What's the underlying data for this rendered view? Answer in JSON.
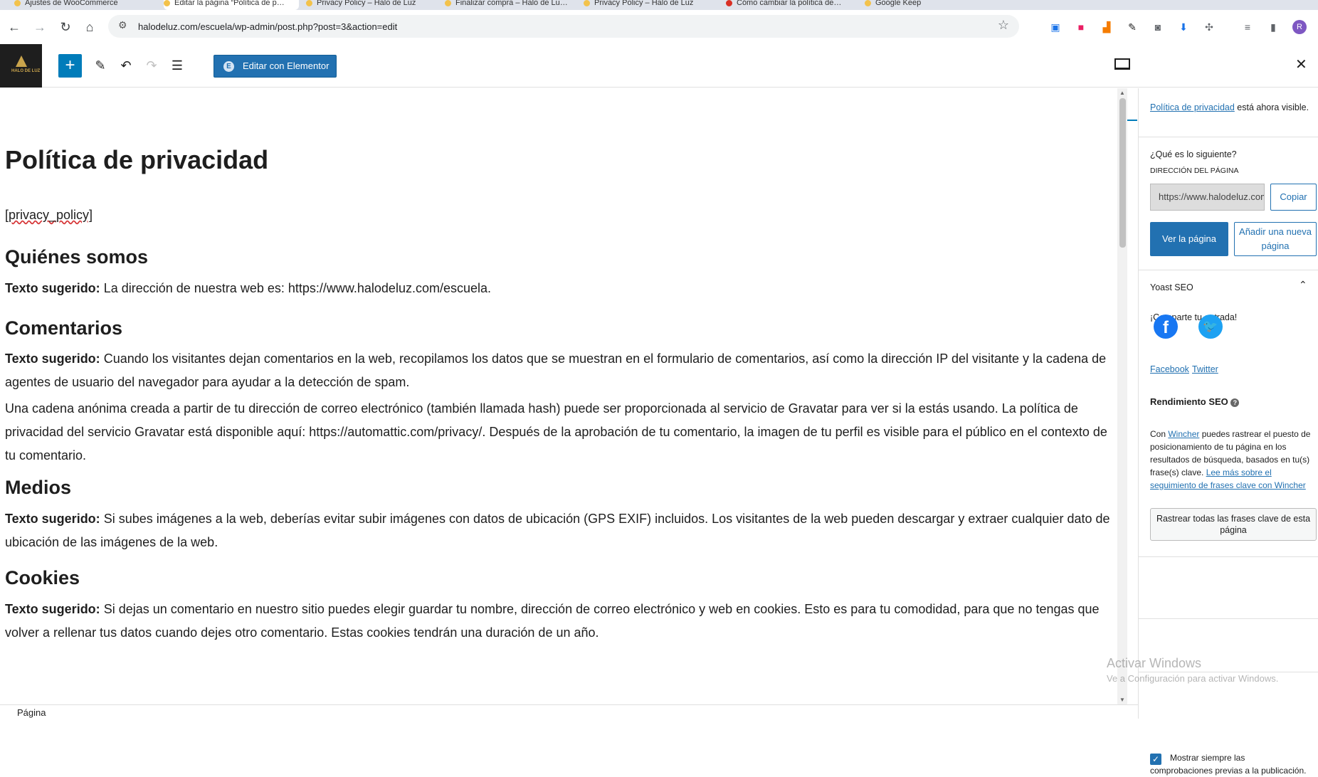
{
  "browser": {
    "tabs": [
      {
        "label": "Ajustes de WooCommerce"
      },
      {
        "label": "Editar la página “Política de p…"
      },
      {
        "label": "Privacy Policy – Halo de Luz"
      },
      {
        "label": "Finalizar compra – Halo de Lu…"
      },
      {
        "label": "Privacy Policy – Halo de Luz"
      },
      {
        "label": "Cómo cambiar la política de…"
      },
      {
        "label": "Google Keep"
      }
    ],
    "url": "halodeluz.com/escuela/wp-admin/post.php?post=3&action=edit",
    "profile_initial": "R"
  },
  "editor": {
    "logo_text": "HALO DE LUZ",
    "edit_elementor_label": "Editar con Elementor",
    "status_bar_label": "Página"
  },
  "content": {
    "title": "Política de privacidad",
    "shortcode": "[privacy_policy]",
    "sections": [
      {
        "heading": "Quiénes somos"
      },
      {
        "heading": "Comentarios"
      },
      {
        "heading": "Medios"
      },
      {
        "heading": "Cookies"
      }
    ],
    "suggested_label": "Texto sugerido:",
    "p_quienes": "La dirección de nuestra web es: https://www.halodeluz.com/escuela.",
    "p_comentarios_1": "Cuando los visitantes dejan comentarios en la web, recopilamos los datos que se muestran en el formulario de comentarios, así como la dirección IP del visitante y la cadena de agentes de usuario del navegador para ayudar a la detección de spam.",
    "p_comentarios_2": "Una cadena anónima creada a partir de tu dirección de correo electrónico (también llamada hash) puede ser proporcionada al servicio de Gravatar para ver si la estás usando. La política de privacidad del servicio Gravatar está disponible aquí: https://automattic.com/privacy/. Después de la aprobación de tu comentario, la imagen de tu perfil es visible para el público en el contexto de tu comentario.",
    "p_medios": "Si subes imágenes a la web, deberías evitar subir imágenes con datos de ubicación (GPS EXIF) incluidos. Los visitantes de la web pueden descargar y extraer cualquier dato de ubicación de las imágenes de la web.",
    "p_cookies": "Si dejas un comentario en nuestro sitio puedes elegir guardar tu nombre, dirección de correo electrónico y web en cookies. Esto es para tu comodidad, para que no tengas que volver a rellenar tus datos cuando dejes otro comentario. Estas cookies tendrán una duración de un año."
  },
  "panel": {
    "notice_link": "Política de privacidad",
    "notice_rest": " está ahora visible.",
    "whats_next": "¿Qué es lo siguiente?",
    "page_address_label": "DIRECCIÓN DEL PÁGINA",
    "page_address_value": "https://www.halodeluz.com/escuela/",
    "copy_label": "Copiar",
    "view_page_label": "Ver la página",
    "add_new_label": "Añadir una nueva página",
    "yoast_title": "Yoast SEO",
    "share_label": "¡Comparte tu entrada!",
    "facebook_label": "Facebook",
    "twitter_label": "Twitter",
    "seo_perf_title": "Rendimiento SEO",
    "wincher_pre": "Con ",
    "wincher_link": "Wincher",
    "wincher_mid": " puedes rastrear el puesto de posicionamiento de tu página en los resultados de búsqueda, basados en tu(s) frase(s) clave. ",
    "wincher_more": "Lee más sobre el seguimiento de frases clave con Wincher",
    "track_all_label": "Rastrear todas las frases clave de esta página",
    "always_show_label": "Mostrar siempre las comprobaciones previas a la publicación."
  },
  "os": {
    "watermark_title": "Activar Windows",
    "watermark_sub": "Ve a Configuración para activar Windows."
  }
}
